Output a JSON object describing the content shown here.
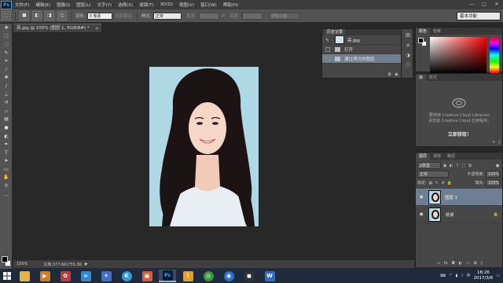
{
  "menubar": {
    "logo": "Ps",
    "items": [
      "文件(F)",
      "编辑(E)",
      "图像(I)",
      "图层(L)",
      "文字(Y)",
      "选择(S)",
      "滤镜(T)",
      "3D(D)",
      "视图(V)",
      "窗口(W)",
      "帮助(H)"
    ],
    "minimize": "—",
    "maximize": "□",
    "close": "✕"
  },
  "options": {
    "feather_label": "羽化:",
    "feather_value": "0 像素",
    "antialias": "消除锯齿",
    "style_label": "样式:",
    "style_value": "正常",
    "width_label": "宽度:",
    "height_label": "高度:",
    "refine_edge": "调整边缘...",
    "workspace": "基本功能"
  },
  "document": {
    "tab_title": "亮.jpg @ 100% (图层 1, RGB/8#) *",
    "close": "×"
  },
  "history": {
    "tab": "历史记录",
    "snapshot_name": "亮.jpg",
    "steps": [
      "打开",
      "通过拷贝的图层"
    ]
  },
  "color_panel": {
    "tabs": [
      "颜色",
      "色板"
    ]
  },
  "libraries_panel": {
    "tabs": [
      "库",
      "样式"
    ],
    "message_line1": "要使用 Creative Cloud Libraries,",
    "message_line2": "请安装 Creative Cloud 应用程序。",
    "link": "立即获取！"
  },
  "layers_panel": {
    "tabs": [
      "图层",
      "通道",
      "路径"
    ],
    "filter": "ρ类型",
    "blend_mode": "正常",
    "opacity_label": "不透明度:",
    "opacity_value": "100%",
    "lock_label": "锁定:",
    "fill_label": "填充:",
    "fill_value": "100%",
    "layers": [
      {
        "name": "图层 1",
        "selected": true
      },
      {
        "name": "背景",
        "selected": false
      }
    ]
  },
  "statusbar": {
    "zoom": "100%",
    "doc_info": "文档:377.6K/755.3K"
  },
  "taskbar": {
    "time": "18:26",
    "date": "2017/3/6"
  },
  "colors": {
    "accent_selection": "#6e7f92",
    "photo_background": "#add8e4",
    "ps_blue": "#31a8ff"
  }
}
